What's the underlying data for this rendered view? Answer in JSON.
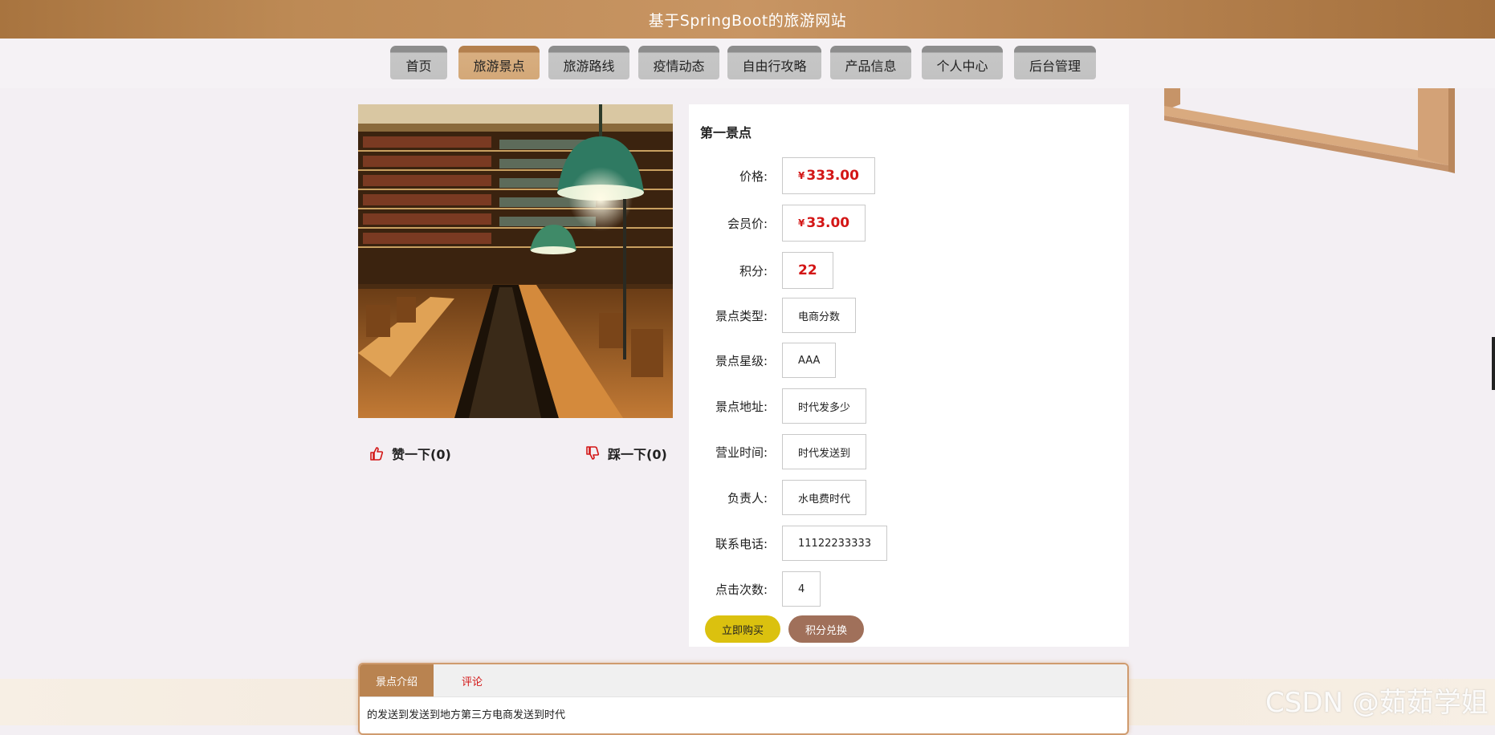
{
  "header": {
    "title": "基于SpringBoot的旅游网站"
  },
  "nav": {
    "items": [
      {
        "label": "首页"
      },
      {
        "label": "旅游景点"
      },
      {
        "label": "旅游路线"
      },
      {
        "label": "疫情动态"
      },
      {
        "label": "自由行攻略"
      },
      {
        "label": "产品信息"
      },
      {
        "label": "个人中心"
      },
      {
        "label": "后台管理"
      }
    ],
    "active_index": 1
  },
  "votes": {
    "like_label": "赞一下(0)",
    "dislike_label": "踩一下(0)"
  },
  "detail": {
    "title": "第一景点",
    "price": {
      "label": "价格:",
      "currency": "¥",
      "value": "333.00"
    },
    "member_price": {
      "label": "会员价:",
      "currency": "¥",
      "value": "33.00"
    },
    "points": {
      "label": "积分:",
      "value": "22"
    },
    "type": {
      "label": "景点类型:",
      "value": "电商分数"
    },
    "star": {
      "label": "景点星级:",
      "value": "AAA"
    },
    "address": {
      "label": "景点地址:",
      "value": "时代发多少"
    },
    "hours": {
      "label": "营业时间:",
      "value": "时代发送到"
    },
    "manager": {
      "label": "负责人:",
      "value": "水电费时代"
    },
    "phone": {
      "label": "联系电话:",
      "value": "11122233333"
    },
    "clicks": {
      "label": "点击次数:",
      "value": "4"
    },
    "buy_label": "立即购买",
    "exchange_label": "积分兑换"
  },
  "tabs": {
    "items": [
      {
        "label": "景点介绍"
      },
      {
        "label": "评论"
      }
    ],
    "content": "的发送到发送到地方第三方电商发送到时代"
  },
  "watermark": "CSDN @茹茹学姐",
  "colors": {
    "header": "#bd8a55",
    "nav_active": "#d3a878",
    "nav_default": "#c2c2c2",
    "price_red": "#d31616",
    "buy_button": "#dbc10f",
    "exchange_button": "#a0705a",
    "tab_active": "#b98350"
  }
}
